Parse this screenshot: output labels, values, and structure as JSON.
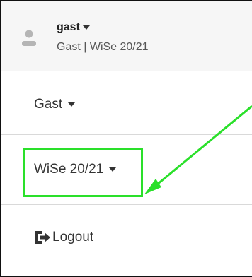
{
  "header": {
    "username": "gast",
    "subline": "Gast | WiSe 20/21"
  },
  "menu": {
    "role_label": "Gast",
    "semester_label": "WiSe 20/21",
    "logout_label": "Logout"
  },
  "colors": {
    "highlight": "#2ae02a",
    "text": "#333333",
    "header_bg": "#f6f6f6"
  },
  "icons": {
    "avatar": "user-icon",
    "logout": "logout-icon",
    "caret": "caret-down-icon"
  }
}
